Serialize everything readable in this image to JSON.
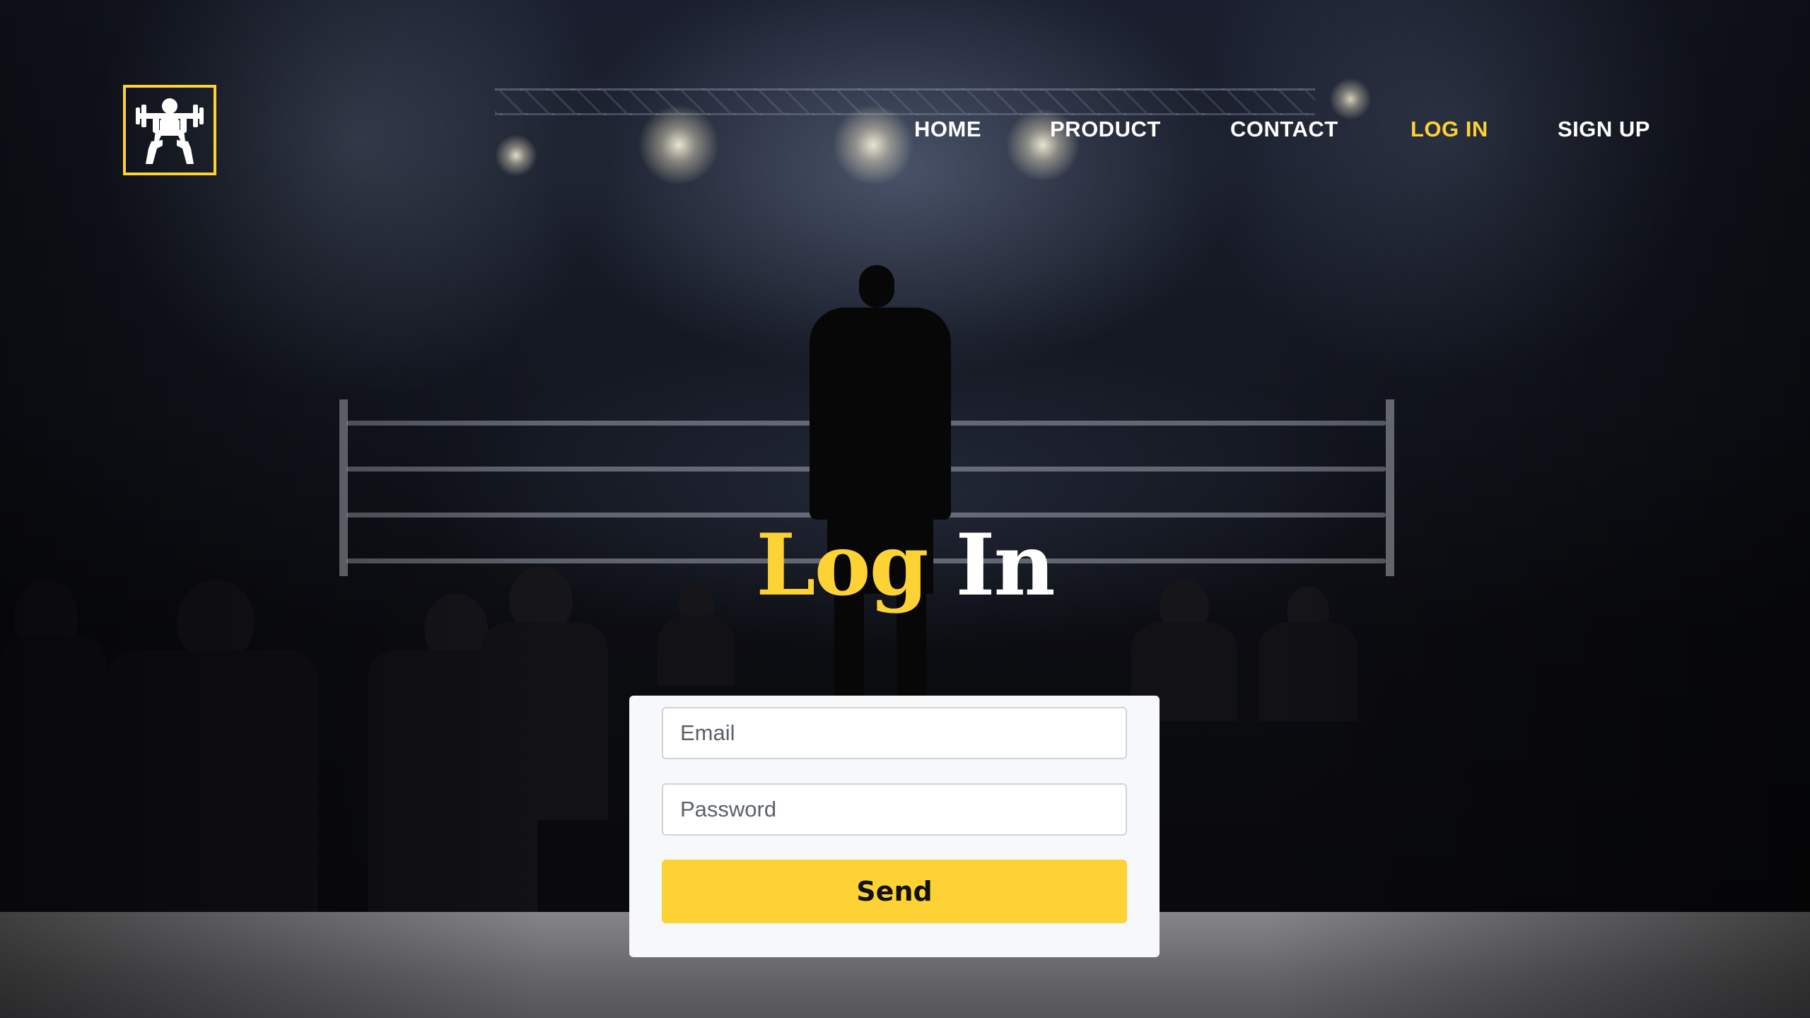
{
  "brand": {
    "logo_icon": "weightlifter-icon",
    "accent_color": "#fcd235"
  },
  "nav": {
    "items": [
      {
        "label": "HOME",
        "active": false
      },
      {
        "label": "PRODUCT",
        "active": false
      },
      {
        "label": "CONTACT",
        "active": false
      },
      {
        "label": "LOG IN",
        "active": true
      },
      {
        "label": "SIGN UP",
        "active": false
      }
    ]
  },
  "hero": {
    "title_word1": "Log",
    "title_word2": "In"
  },
  "login_form": {
    "email_placeholder": "Email",
    "email_value": "",
    "password_placeholder": "Password",
    "password_value": "",
    "submit_label": "Send"
  }
}
